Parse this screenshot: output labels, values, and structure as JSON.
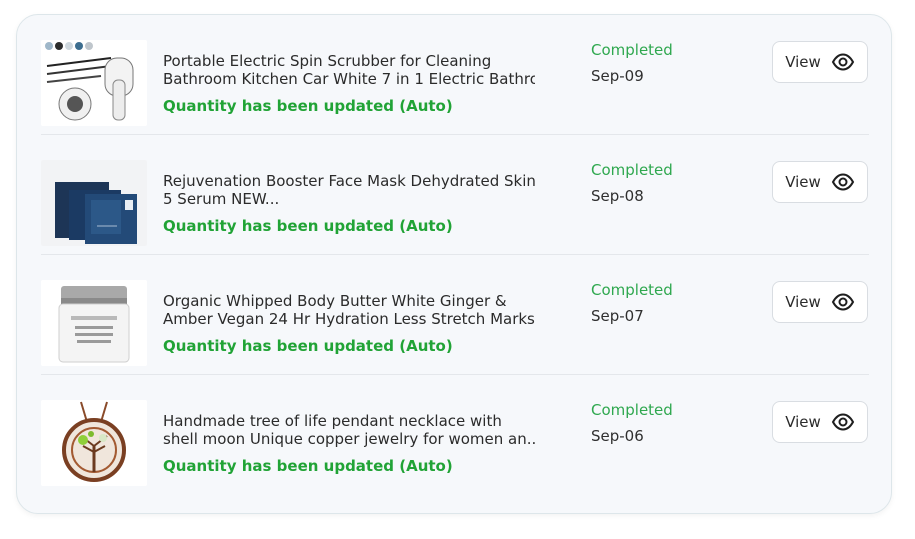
{
  "orders": [
    {
      "title_line1": "Portable Electric Spin Scrubber for Cleaning",
      "title_line2": "Bathroom Kitchen Car White 7 in 1 Electric Bathro...",
      "quantity_note": "Quantity has been updated (Auto)",
      "status": "Completed",
      "date": "Sep-09",
      "view_label": "View",
      "image_icon": "spin-scrubber-product-image"
    },
    {
      "title_line1": "Rejuvenation Booster Face Mask Dehydrated Skin",
      "title_line2": "5 Serum NEW...",
      "quantity_note": "Quantity has been updated (Auto)",
      "status": "Completed",
      "date": "Sep-08",
      "view_label": "View",
      "image_icon": "face-mask-product-image"
    },
    {
      "title_line1": "Organic Whipped Body Butter White Ginger &",
      "title_line2": "Amber Vegan 24 Hr Hydration Less Stretch Marks...",
      "quantity_note": "Quantity has been updated (Auto)",
      "status": "Completed",
      "date": "Sep-07",
      "view_label": "View",
      "image_icon": "body-butter-product-image"
    },
    {
      "title_line1": "Handmade tree of life pendant necklace with",
      "title_line2": "shell moon Unique copper jewelry for women an...",
      "quantity_note": "Quantity has been updated (Auto)",
      "status": "Completed",
      "date": "Sep-06",
      "view_label": "View",
      "image_icon": "pendant-necklace-product-image"
    }
  ],
  "colors": {
    "status_green": "#2fa84f",
    "quantity_green": "#21a336",
    "card_bg": "#f6f8fb"
  }
}
